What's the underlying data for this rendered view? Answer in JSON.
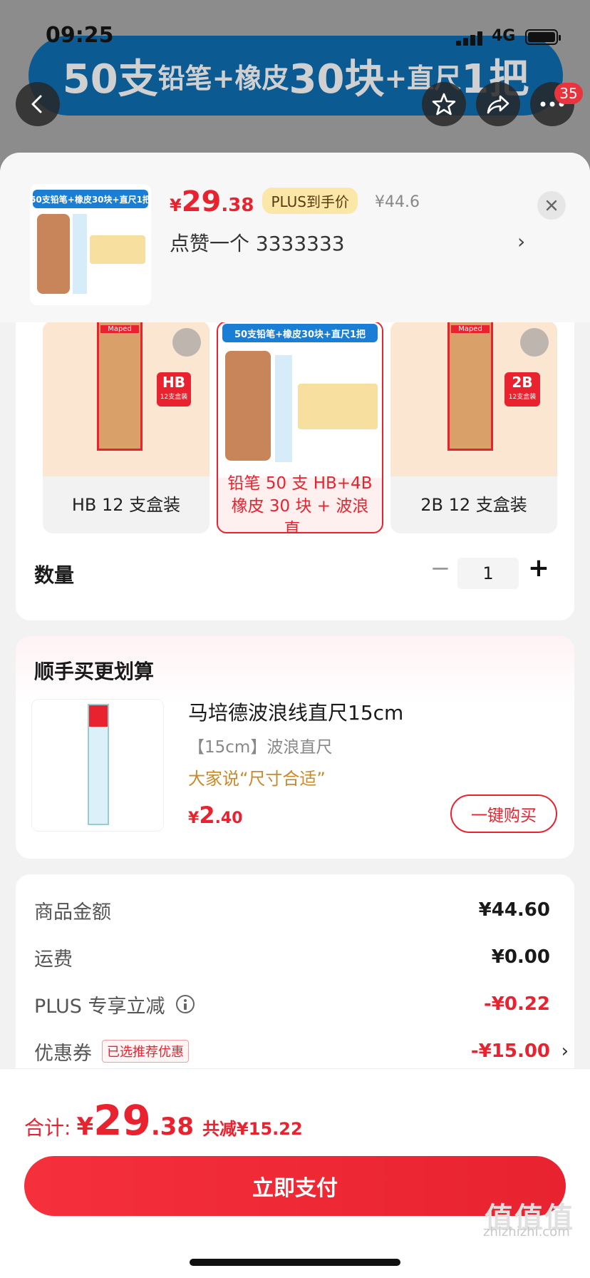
{
  "status_bar": {
    "time": "09:25",
    "network": "4G"
  },
  "banner": {
    "part1": "50支",
    "part2": "铅笔+橡皮",
    "part3": "30块",
    "part4": "+直尺",
    "part5": "1把"
  },
  "nav": {
    "badge_count": "35"
  },
  "product": {
    "currency": "¥",
    "price_int": "29",
    "price_dec": ".38",
    "plus_tag": "PLUS到手价",
    "original_price": "¥44.6",
    "selection_text": "点赞一个  3333333",
    "thumb_banner": "50支铅笔+橡皮30块+直尺1把"
  },
  "variants": [
    {
      "label": "HB 12 支盒装",
      "box_badge": "HB",
      "box_sub": "12支盒装",
      "brand": "Maped"
    },
    {
      "label": "铅笔 50 支 HB+4B 橡皮 30 块 + 波浪直...",
      "top_text": "50支铅笔+橡皮30块+直尺1把",
      "selected": true
    },
    {
      "label": "2B 12 支盒装",
      "box_badge": "2B",
      "box_sub": "12支盒装",
      "brand": "Maped"
    }
  ],
  "quantity": {
    "label": "数量",
    "value": "1",
    "minus": "−",
    "plus": "+"
  },
  "bundle": {
    "title": "顺手买更划算",
    "name": "马培德波浪线直尺15cm",
    "spec": "【15cm】波浪直尺",
    "review": "大家说“尺寸合适”",
    "currency": "¥",
    "price_int": "2",
    "price_dec": ".40",
    "buy_label": "一键购买"
  },
  "summary": {
    "rows": [
      {
        "label": "商品金额",
        "value": "¥44.60"
      },
      {
        "label": "运费",
        "value": "¥0.00"
      },
      {
        "label": "PLUS 专享立减",
        "value": "-¥0.22"
      },
      {
        "label": "优惠券",
        "tag": "已选推荐优惠",
        "value": "-¥15.00"
      }
    ]
  },
  "footer": {
    "total_label": "合计:",
    "total_currency": "¥",
    "total_int": "29",
    "total_dec": ".38",
    "total_saving": "共减¥15.22",
    "pay_label": "立即支付",
    "watermark": "zhizhizhi.com",
    "watermark_logo": "值值值"
  },
  "colors": {
    "accent": "#e8232f",
    "banner_blue": "#0b5a92",
    "plus_gold": "#fbe7a8",
    "review_gold": "#c98a2b"
  }
}
